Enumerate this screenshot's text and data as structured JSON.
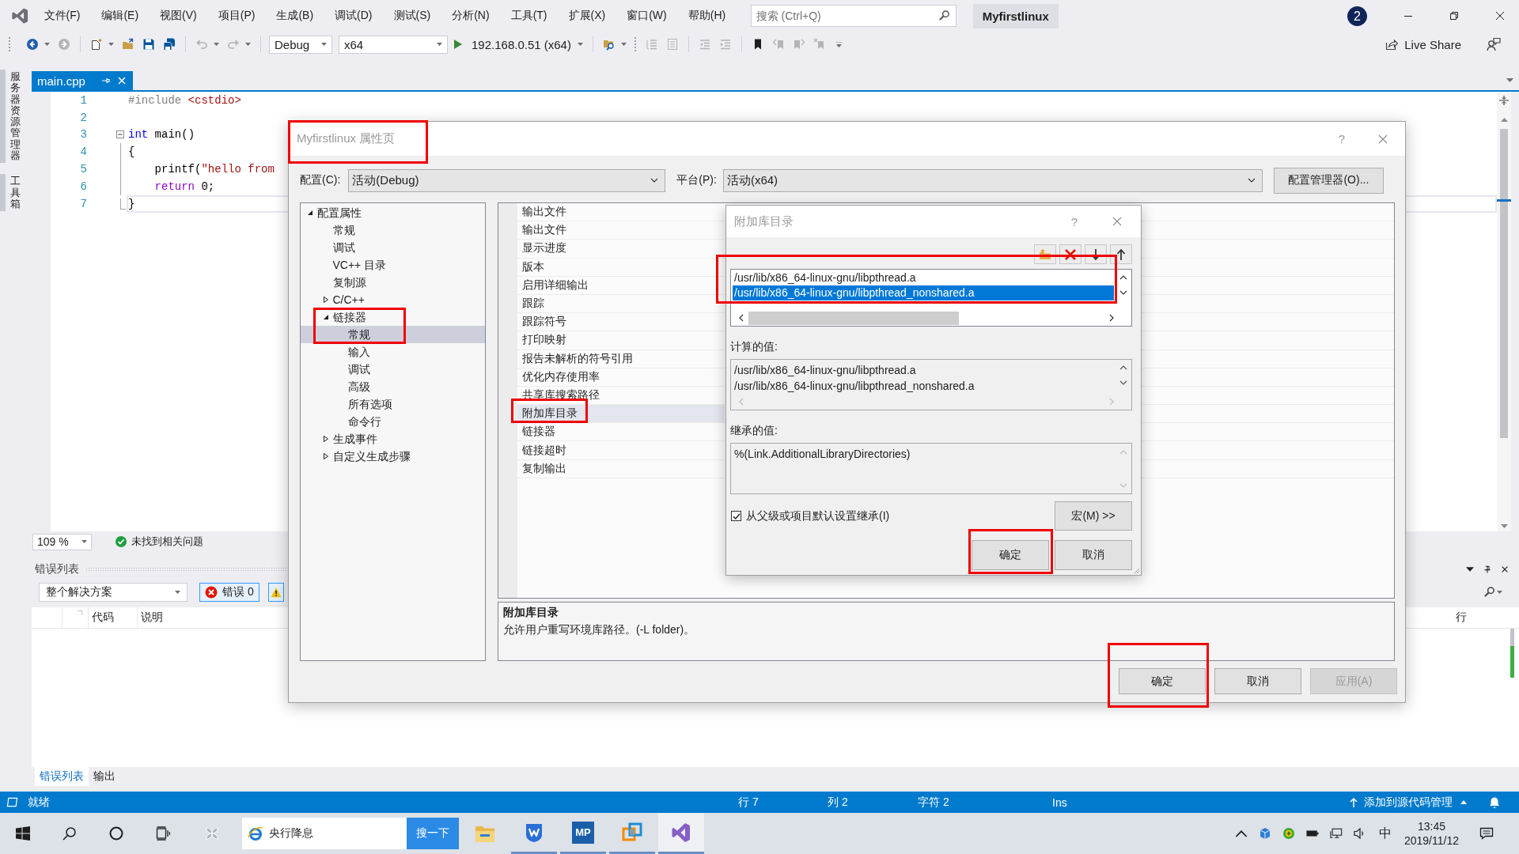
{
  "menu_bar": {
    "items": [
      "文件(F)",
      "编辑(E)",
      "视图(V)",
      "项目(P)",
      "生成(B)",
      "调试(D)",
      "测试(S)",
      "分析(N)",
      "工具(T)",
      "扩展(X)",
      "窗口(W)",
      "帮助(H)"
    ],
    "search": {
      "placeholder": "搜索 (Ctrl+Q)"
    },
    "solution_name": "Myfirstlinux",
    "notification_count": "2"
  },
  "toolbar": {
    "icons": [
      {
        "disabled": false
      },
      {
        "disabled": true
      },
      {
        "disabled": false
      },
      {
        "disabled": false
      },
      {
        "disabled": false
      },
      {
        "disabled": false
      },
      {
        "disabled": true
      },
      {
        "disabled": true
      },
      {
        "disabled": false
      },
      {
        "disabled": true
      },
      {
        "disabled": true
      },
      {
        "disabled": true
      },
      {
        "disabled": true
      },
      {
        "disabled": false
      },
      {
        "disabled": true
      },
      {
        "disabled": true
      },
      {
        "disabled": true
      }
    ],
    "configuration": "Debug",
    "platform": "x64",
    "start_target": "192.168.0.51 (x64)",
    "live_share": "Live Share"
  },
  "side_tabs": [
    "服务器资源管理器",
    "工具箱"
  ],
  "document_tabs": [
    {
      "label": "main.cpp",
      "selected": true
    }
  ],
  "editor": {
    "lines": [
      {
        "number": "1",
        "current": false,
        "tokens": [
          {
            "text": "#include",
            "kind": "directive"
          },
          {
            "text": " <cstdio>",
            "kind": "include_path"
          }
        ]
      },
      {
        "number": "2",
        "current": false
      },
      {
        "number": "3",
        "current": false,
        "fold_open": true,
        "tokens": [
          {
            "text": "int",
            "kind": "keyword"
          },
          {
            "text": " main()",
            "kind": "plain"
          }
        ]
      },
      {
        "number": "4",
        "current": false,
        "tokens": [
          {
            "text": "{",
            "kind": "plain"
          }
        ]
      },
      {
        "number": "5",
        "current": false,
        "tokens": [
          {
            "text": "    printf(",
            "kind": "plain"
          },
          {
            "text": "\"hello from",
            "kind": "string"
          }
        ]
      },
      {
        "number": "6",
        "current": false,
        "tokens": [
          {
            "text": "    return",
            "kind": "control"
          },
          {
            "text": " 0;",
            "kind": "plain"
          }
        ]
      },
      {
        "number": "7",
        "current": true,
        "tokens": [
          {
            "text": "}",
            "kind": "plain"
          }
        ]
      }
    ]
  },
  "editor_footer": {
    "zoom": "109 %",
    "issues": "未找到相关问题"
  },
  "error_list": {
    "title": "错误列表",
    "scope": "整个解决方案",
    "error_filter": {
      "label": "错误 0",
      "on": true
    },
    "warning_filter": {
      "on": true
    },
    "columns": [
      "代码",
      "说明",
      "行"
    ],
    "tabs": [
      {
        "label": "错误列表",
        "selected": true
      },
      {
        "label": "输出",
        "selected": false
      }
    ]
  },
  "status_bar": {
    "state": "就绪",
    "line": "行 7",
    "column": "列 2",
    "character": "字符 2",
    "mode": "Ins",
    "source_control": "添加到源代码管理"
  },
  "taskbar": {
    "search_text": "央行降息",
    "search_button": "搜一下",
    "apps": [
      {
        "running": false
      },
      {
        "running": true
      },
      {
        "label": "MP",
        "running": true
      },
      {
        "running": true
      },
      {
        "running": true
      }
    ],
    "input_method": "中",
    "time": "13:45",
    "date": "2019/11/12"
  },
  "property_dialog": {
    "title": "Myfirstlinux 属性页",
    "help": "?",
    "configuration_label": "配置(C):",
    "configuration": "活动(Debug)",
    "platform_label": "平台(P):",
    "platform": "活动(x64)",
    "manager_button": "配置管理器(O)...",
    "tree": [
      {
        "label": "配置属性",
        "expanded": true,
        "selected": false,
        "children": [
          {
            "label": "常规",
            "selected": false
          },
          {
            "label": "调试",
            "selected": false
          },
          {
            "label": "VC++ 目录",
            "selected": false
          },
          {
            "label": "复制源",
            "selected": false
          },
          {
            "label": "C/C++",
            "expanded": false,
            "selected": false
          },
          {
            "label": "链接器",
            "expanded": true,
            "selected": false,
            "children": [
              {
                "label": "常规",
                "selected": true
              },
              {
                "label": "输入",
                "selected": false
              },
              {
                "label": "调试",
                "selected": false
              },
              {
                "label": "高级",
                "selected": false
              },
              {
                "label": "所有选项",
                "selected": false
              },
              {
                "label": "命令行",
                "selected": false
              }
            ]
          },
          {
            "label": "生成事件",
            "expanded": false,
            "selected": false
          },
          {
            "label": "自定义生成步骤",
            "expanded": false,
            "selected": false
          }
        ]
      }
    ],
    "properties": [
      {
        "name": "输出文件",
        "selected": false
      },
      {
        "name": "输出文件",
        "selected": false
      },
      {
        "name": "显示进度",
        "selected": false
      },
      {
        "name": "版本",
        "selected": false
      },
      {
        "name": "启用详细输出",
        "selected": false
      },
      {
        "name": "跟踪",
        "selected": false
      },
      {
        "name": "跟踪符号",
        "selected": false
      },
      {
        "name": "打印映射",
        "selected": false
      },
      {
        "name": "报告未解析的符号引用",
        "selected": false
      },
      {
        "name": "优化内存使用率",
        "selected": false
      },
      {
        "name": "共享库搜索路径",
        "selected": false
      },
      {
        "name": "附加库目录",
        "selected": true
      },
      {
        "name": "链接器",
        "selected": false
      },
      {
        "name": "链接超时",
        "selected": false
      },
      {
        "name": "复制输出",
        "selected": false
      }
    ],
    "description": {
      "title": "附加库目录",
      "text": "允许用户重写环境库路径。(-L folder)。"
    },
    "buttons": [
      {
        "label": "确定",
        "disabled": false
      },
      {
        "label": "取消",
        "disabled": false
      },
      {
        "label": "应用(A)",
        "disabled": true
      }
    ]
  },
  "library_dialog": {
    "title": "附加库目录",
    "help": "?",
    "entries": [
      {
        "path": "/usr/lib/x86_64-linux-gnu/libpthread.a",
        "selected": false
      },
      {
        "path": "/usr/lib/x86_64-linux-gnu/libpthread_nonshared.a",
        "selected": true
      }
    ],
    "computed_label": "计算的值:",
    "computed_values": [
      "/usr/lib/x86_64-linux-gnu/libpthread.a",
      "/usr/lib/x86_64-linux-gnu/libpthread_nonshared.a"
    ],
    "inherited_label": "继承的值:",
    "inherited_values": [
      "%(Link.AdditionalLibraryDirectories)"
    ],
    "inherit_checkbox": {
      "label": "从父级或项目默认设置继承(I)",
      "checked": true
    },
    "macros_button": "宏(M) >>",
    "buttons": [
      "确定",
      "取消"
    ]
  }
}
